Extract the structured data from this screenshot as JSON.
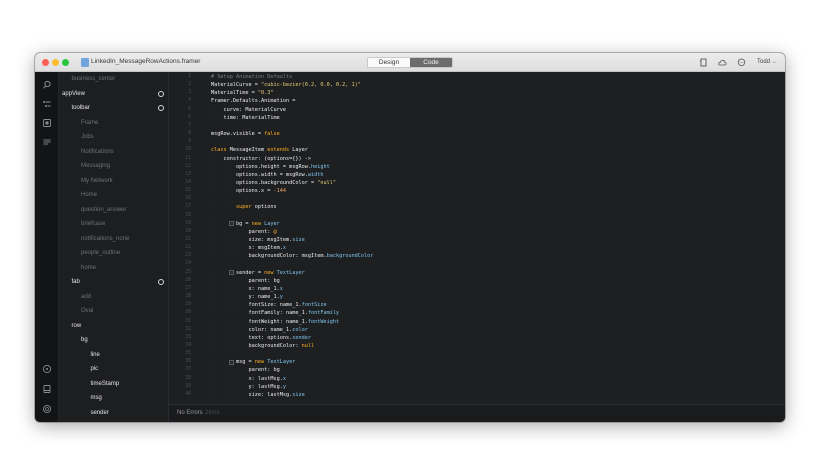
{
  "window": {
    "title": "LinkedIn_MessageRowActions.framer",
    "modes": [
      {
        "label": "Design",
        "active": false
      },
      {
        "label": "Code",
        "active": true
      }
    ],
    "user": "Todd",
    "toolbar_icons": [
      "page-icon",
      "cloud-icon",
      "comment-icon"
    ]
  },
  "rail": {
    "top_icons": [
      "search-icon",
      "layers-tree-icon",
      "frame-icon",
      "list-icon"
    ],
    "bottom_icons": [
      "info-icon",
      "device-icon",
      "preview-icon"
    ]
  },
  "layers": [
    {
      "label": "business_center",
      "depth": 1,
      "bright": false,
      "dot": false
    },
    {
      "label": "appView",
      "depth": 0,
      "bright": true,
      "dot": true
    },
    {
      "label": "toolbar",
      "depth": 1,
      "bright": true,
      "dot": true
    },
    {
      "label": "Frame",
      "depth": 2,
      "bright": false,
      "dot": false
    },
    {
      "label": "Jobs",
      "depth": 2,
      "bright": false,
      "dot": false
    },
    {
      "label": "Notifications",
      "depth": 2,
      "bright": false,
      "dot": false
    },
    {
      "label": "Messaging",
      "depth": 2,
      "bright": false,
      "dot": false
    },
    {
      "label": "My Network",
      "depth": 2,
      "bright": false,
      "dot": false
    },
    {
      "label": "Home",
      "depth": 2,
      "bright": false,
      "dot": false
    },
    {
      "label": "question_answer",
      "depth": 2,
      "bright": false,
      "dot": false
    },
    {
      "label": "briefcase",
      "depth": 2,
      "bright": false,
      "dot": false
    },
    {
      "label": "notifications_none",
      "depth": 2,
      "bright": false,
      "dot": false
    },
    {
      "label": "people_outline",
      "depth": 2,
      "bright": false,
      "dot": false
    },
    {
      "label": "home",
      "depth": 2,
      "bright": false,
      "dot": false
    },
    {
      "label": "fab",
      "depth": 1,
      "bright": true,
      "dot": true
    },
    {
      "label": "add",
      "depth": 2,
      "bright": false,
      "dot": false
    },
    {
      "label": "Oval",
      "depth": 2,
      "bright": false,
      "dot": false
    },
    {
      "label": "row",
      "depth": 1,
      "bright": true,
      "dot": false
    },
    {
      "label": "bg",
      "depth": 2,
      "bright": true,
      "dot": false
    },
    {
      "label": "line",
      "depth": 3,
      "bright": true,
      "dot": false
    },
    {
      "label": "pic",
      "depth": 3,
      "bright": true,
      "dot": false
    },
    {
      "label": "timeStamp",
      "depth": 3,
      "bright": true,
      "dot": false
    },
    {
      "label": "msg",
      "depth": 3,
      "bright": true,
      "dot": false
    },
    {
      "label": "sender",
      "depth": 3,
      "bright": true,
      "dot": false
    }
  ],
  "code": {
    "first_line": 1,
    "folds": [
      19,
      25,
      36
    ],
    "lines": [
      {
        "indent": 0,
        "tokens": [
          [
            "cm",
            "# Setup Animation Defaults"
          ]
        ]
      },
      {
        "indent": 0,
        "tokens": [
          [
            "txt",
            "MaterialCurve = "
          ],
          [
            "str",
            "\"cubic-bezier(0.2, 0.0, 0.2, 1)\""
          ]
        ]
      },
      {
        "indent": 0,
        "tokens": [
          [
            "txt",
            "MaterialTime = "
          ],
          [
            "str",
            "\"0.3\""
          ]
        ]
      },
      {
        "indent": 0,
        "tokens": [
          [
            "txt",
            "Framer.Defaults.Animation ="
          ]
        ]
      },
      {
        "indent": 1,
        "tokens": [
          [
            "txt",
            "curve: MaterialCurve"
          ]
        ]
      },
      {
        "indent": 1,
        "tokens": [
          [
            "txt",
            "time: MaterialTime"
          ]
        ]
      },
      {
        "indent": 0,
        "tokens": []
      },
      {
        "indent": 0,
        "tokens": [
          [
            "txt",
            "msgRow.visible = "
          ],
          [
            "kw",
            "false"
          ]
        ]
      },
      {
        "indent": 0,
        "tokens": []
      },
      {
        "indent": 0,
        "tokens": [
          [
            "kw",
            "class "
          ],
          [
            "txt",
            "MessageItem "
          ],
          [
            "kw",
            "extends "
          ],
          [
            "txt",
            "Layer"
          ]
        ]
      },
      {
        "indent": 1,
        "tokens": [
          [
            "txt",
            "constructor: (options={}) ->"
          ]
        ]
      },
      {
        "indent": 2,
        "tokens": [
          [
            "txt",
            "options.height = msgRow."
          ],
          [
            "prop",
            "height"
          ]
        ]
      },
      {
        "indent": 2,
        "tokens": [
          [
            "txt",
            "options.width = msgRow."
          ],
          [
            "prop",
            "width"
          ]
        ]
      },
      {
        "indent": 2,
        "tokens": [
          [
            "txt",
            "options.backgroundColor = "
          ],
          [
            "str",
            "\"null\""
          ]
        ]
      },
      {
        "indent": 2,
        "tokens": [
          [
            "txt",
            "options.x = "
          ],
          [
            "num",
            "-144"
          ]
        ]
      },
      {
        "indent": 0,
        "tokens": []
      },
      {
        "indent": 2,
        "tokens": [
          [
            "kw",
            "super "
          ],
          [
            "txt",
            "options"
          ]
        ]
      },
      {
        "indent": 0,
        "tokens": []
      },
      {
        "indent": 2,
        "tokens": [
          [
            "txt",
            "bg = "
          ],
          [
            "kw",
            "new "
          ],
          [
            "prop",
            "Layer"
          ]
        ]
      },
      {
        "indent": 3,
        "tokens": [
          [
            "txt",
            "parent: "
          ],
          [
            "kw",
            "@"
          ]
        ]
      },
      {
        "indent": 3,
        "tokens": [
          [
            "txt",
            "size: msgItem."
          ],
          [
            "prop",
            "size"
          ]
        ]
      },
      {
        "indent": 3,
        "tokens": [
          [
            "txt",
            "x: msgItem."
          ],
          [
            "prop",
            "x"
          ]
        ]
      },
      {
        "indent": 3,
        "tokens": [
          [
            "txt",
            "backgroundColor: msgItem."
          ],
          [
            "prop",
            "backgroundColor"
          ]
        ]
      },
      {
        "indent": 0,
        "tokens": []
      },
      {
        "indent": 2,
        "tokens": [
          [
            "txt",
            "sender = "
          ],
          [
            "kw",
            "new "
          ],
          [
            "prop",
            "TextLayer"
          ]
        ]
      },
      {
        "indent": 3,
        "tokens": [
          [
            "txt",
            "parent: bg"
          ]
        ]
      },
      {
        "indent": 3,
        "tokens": [
          [
            "txt",
            "x: name_1."
          ],
          [
            "prop",
            "x"
          ]
        ]
      },
      {
        "indent": 3,
        "tokens": [
          [
            "txt",
            "y: name_1."
          ],
          [
            "prop",
            "y"
          ]
        ]
      },
      {
        "indent": 3,
        "tokens": [
          [
            "txt",
            "fontSize: name_1."
          ],
          [
            "prop",
            "fontSize"
          ]
        ]
      },
      {
        "indent": 3,
        "tokens": [
          [
            "txt",
            "fontFamily: name_1."
          ],
          [
            "prop",
            "fontFamily"
          ]
        ]
      },
      {
        "indent": 3,
        "tokens": [
          [
            "txt",
            "fontWeight: name_1."
          ],
          [
            "prop",
            "fontWeight"
          ]
        ]
      },
      {
        "indent": 3,
        "tokens": [
          [
            "txt",
            "color: name_1."
          ],
          [
            "prop",
            "color"
          ]
        ]
      },
      {
        "indent": 3,
        "tokens": [
          [
            "txt",
            "text: options."
          ],
          [
            "prop",
            "sender"
          ]
        ]
      },
      {
        "indent": 3,
        "tokens": [
          [
            "txt",
            "backgroundColor: "
          ],
          [
            "kw",
            "null"
          ]
        ]
      },
      {
        "indent": 0,
        "tokens": []
      },
      {
        "indent": 2,
        "tokens": [
          [
            "txt",
            "msg = "
          ],
          [
            "kw",
            "new "
          ],
          [
            "prop",
            "TextLayer"
          ]
        ]
      },
      {
        "indent": 3,
        "tokens": [
          [
            "txt",
            "parent: bg"
          ]
        ]
      },
      {
        "indent": 3,
        "tokens": [
          [
            "txt",
            "x: lastMsg."
          ],
          [
            "prop",
            "x"
          ]
        ]
      },
      {
        "indent": 3,
        "tokens": [
          [
            "txt",
            "y: lastMsg."
          ],
          [
            "prop",
            "y"
          ]
        ]
      },
      {
        "indent": 3,
        "tokens": [
          [
            "txt",
            "size: lastMsg."
          ],
          [
            "prop",
            "size"
          ]
        ]
      }
    ]
  },
  "status": {
    "message": "No Errors",
    "detail": "26ms"
  },
  "colors": {
    "accent_code_tab": "#6c6c6c",
    "keyword": "#ffb020",
    "string": "#e6d279",
    "property": "#7fc7f0",
    "comment": "#7b7d82"
  }
}
